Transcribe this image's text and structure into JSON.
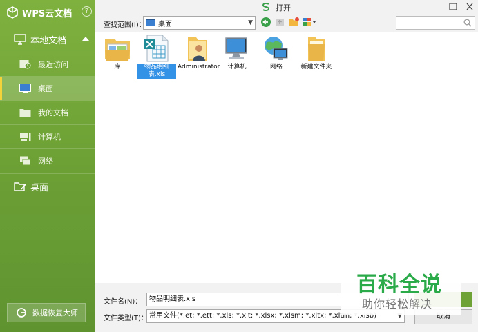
{
  "colors": {
    "accent": "#6ea236",
    "selection": "#3391e6",
    "watermark": "#2aaa49"
  },
  "sidebar": {
    "brand": "WPS云文档",
    "help": "?",
    "local_section": "本地文档",
    "items": [
      {
        "label": "最近访问",
        "icon": "recent-icon"
      },
      {
        "label": "桌面",
        "icon": "desktop-icon",
        "active": true
      },
      {
        "label": "我的文档",
        "icon": "folder-icon"
      },
      {
        "label": "计算机",
        "icon": "computer-icon"
      },
      {
        "label": "网络",
        "icon": "network-icon"
      }
    ],
    "desktop_section": "桌面",
    "recover_button": "数据恢复大师"
  },
  "dialog": {
    "title": "打开",
    "lookin_label": "查找范围(I)：",
    "lookin_value": "桌面",
    "files": [
      {
        "label": "库",
        "icon": "library-icon"
      },
      {
        "label": "物品明细表.xls",
        "icon": "excel-file-icon",
        "selected": true
      },
      {
        "label": "Administrator",
        "icon": "user-folder-icon"
      },
      {
        "label": "计算机",
        "icon": "computer-icon"
      },
      {
        "label": "网络",
        "icon": "network-icon"
      },
      {
        "label": "新建文件夹",
        "icon": "folder-icon"
      }
    ],
    "filename_label": "文件名(N)：",
    "filename_value": "物品明细表.xls",
    "filetype_label": "文件类型(T)：",
    "filetype_value": "常用文件(*.et; *.ett; *.xls; *.xlt; *.xlsx; *.xlsm; *.xltx; *.xltm; *.xlsb)",
    "cancel_label": "取消"
  },
  "watermark": {
    "title": "百科全说",
    "subtitle": "助你轻松解决"
  }
}
